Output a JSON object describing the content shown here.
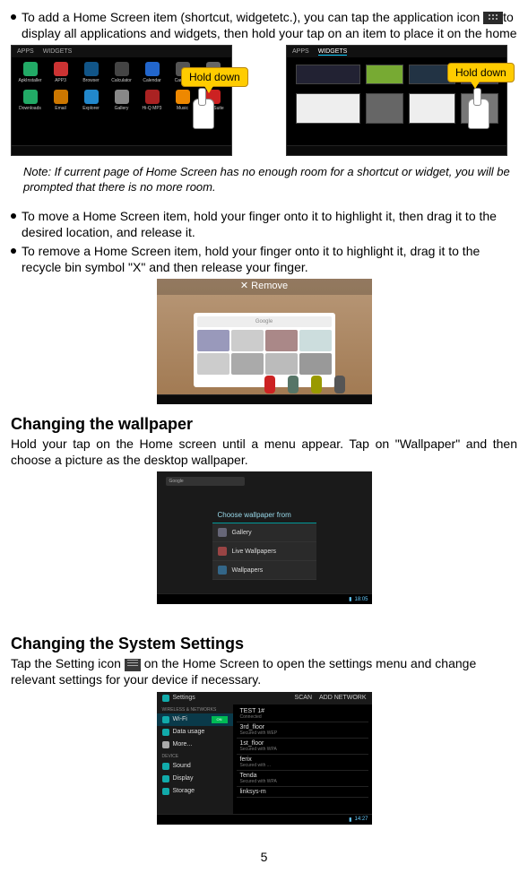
{
  "bullets": {
    "add_a": "To add a Home Screen item (shortcut, widgetetc.), you can tap the application icon",
    "add_b": "to display all applications and widgets, then hold your tap on an item to place it on the home",
    "move": "To move a Home Screen item, hold your finger onto it to highlight it, then drag it to the desired location, and release it.",
    "remove": "To remove a Home Screen item, hold your finger onto it to highlight it, drag it to the recycle bin symbol \"X\" and then release your finger."
  },
  "callouts": {
    "hold_down_1": "Hold down",
    "hold_down_2": "Hold down"
  },
  "apps_screen": {
    "tab1": "APPS",
    "tab2": "WIDGETS",
    "items": [
      {
        "label": "ApkInstaller",
        "color": "#2a6"
      },
      {
        "label": "APP3",
        "color": "#c33"
      },
      {
        "label": "Browser",
        "color": "#158"
      },
      {
        "label": "Calculator",
        "color": "#444"
      },
      {
        "label": "Calendar",
        "color": "#26c"
      },
      {
        "label": "Camera",
        "color": "#555"
      },
      {
        "label": "Clock",
        "color": "#666"
      },
      {
        "label": "Downloads",
        "color": "#2a6"
      },
      {
        "label": "Email",
        "color": "#c70"
      },
      {
        "label": "Explorer",
        "color": "#28c"
      },
      {
        "label": "Gallery",
        "color": "#888"
      },
      {
        "label": "Hi-Q MP3",
        "color": "#a22"
      },
      {
        "label": "Music",
        "color": "#e80"
      },
      {
        "label": "OfficeSuite",
        "color": "#c22"
      }
    ]
  },
  "widgets_screen": {
    "tab1": "APPS",
    "tab2": "WIDGETS"
  },
  "note": "Note: If current page of Home Screen has no enough room for a shortcut or widget, you will be prompted that there is no more room.",
  "recycle": {
    "left": "",
    "right": "",
    "x": "✕ Remove",
    "google": "Google",
    "dock_colors": [
      "#c22",
      "#567567",
      "#990",
      "#555"
    ]
  },
  "h_wallpaper": "Changing the wallpaper",
  "p_wallpaper": "Hold your tap on the Home screen until a menu appear. Tap on \"Wallpaper\" and then choose a picture as the desktop wallpaper.",
  "wallpaper_shot": {
    "search": "Google",
    "dialog_title": "Choose wallpaper from",
    "rows": [
      {
        "label": "Gallery",
        "color": "#667"
      },
      {
        "label": "Live Wallpapers",
        "color": "#944"
      },
      {
        "label": "Wallpapers",
        "color": "#368"
      }
    ],
    "time": "18:05",
    "batt": "▮"
  },
  "h_settings": "Changing the System Settings",
  "p_settings_a": "Tap the Setting icon",
  "p_settings_b": " on the Home Screen to open the settings menu and change relevant settings for your device if necessary.",
  "settings_shot": {
    "title": "Settings",
    "scan": "SCAN",
    "addnet": "ADD NETWORK",
    "section1": "WIRELESS & NETWORKS",
    "section2": "DEVICE",
    "left": [
      {
        "label": "Wi-Fi",
        "color": "#1aa",
        "active": true,
        "switch": "ON"
      },
      {
        "label": "Data usage",
        "color": "#1aa"
      },
      {
        "label": "More...",
        "color": "#aaa"
      },
      {
        "label": "Sound",
        "color": "#1aa"
      },
      {
        "label": "Display",
        "color": "#1aa"
      },
      {
        "label": "Storage",
        "color": "#1aa"
      }
    ],
    "networks": [
      {
        "name": "TEST 1#",
        "sub": "Connected"
      },
      {
        "name": "3rd_floor",
        "sub": "Secured with WEP"
      },
      {
        "name": "1st_floor",
        "sub": "Secured with WPA"
      },
      {
        "name": "ferix",
        "sub": "Secured with ..."
      },
      {
        "name": "Tenda",
        "sub": "Secured with WPA"
      },
      {
        "name": "linksys-m",
        "sub": ""
      }
    ],
    "time": "14:27",
    "batt": "▮"
  },
  "page": "5"
}
